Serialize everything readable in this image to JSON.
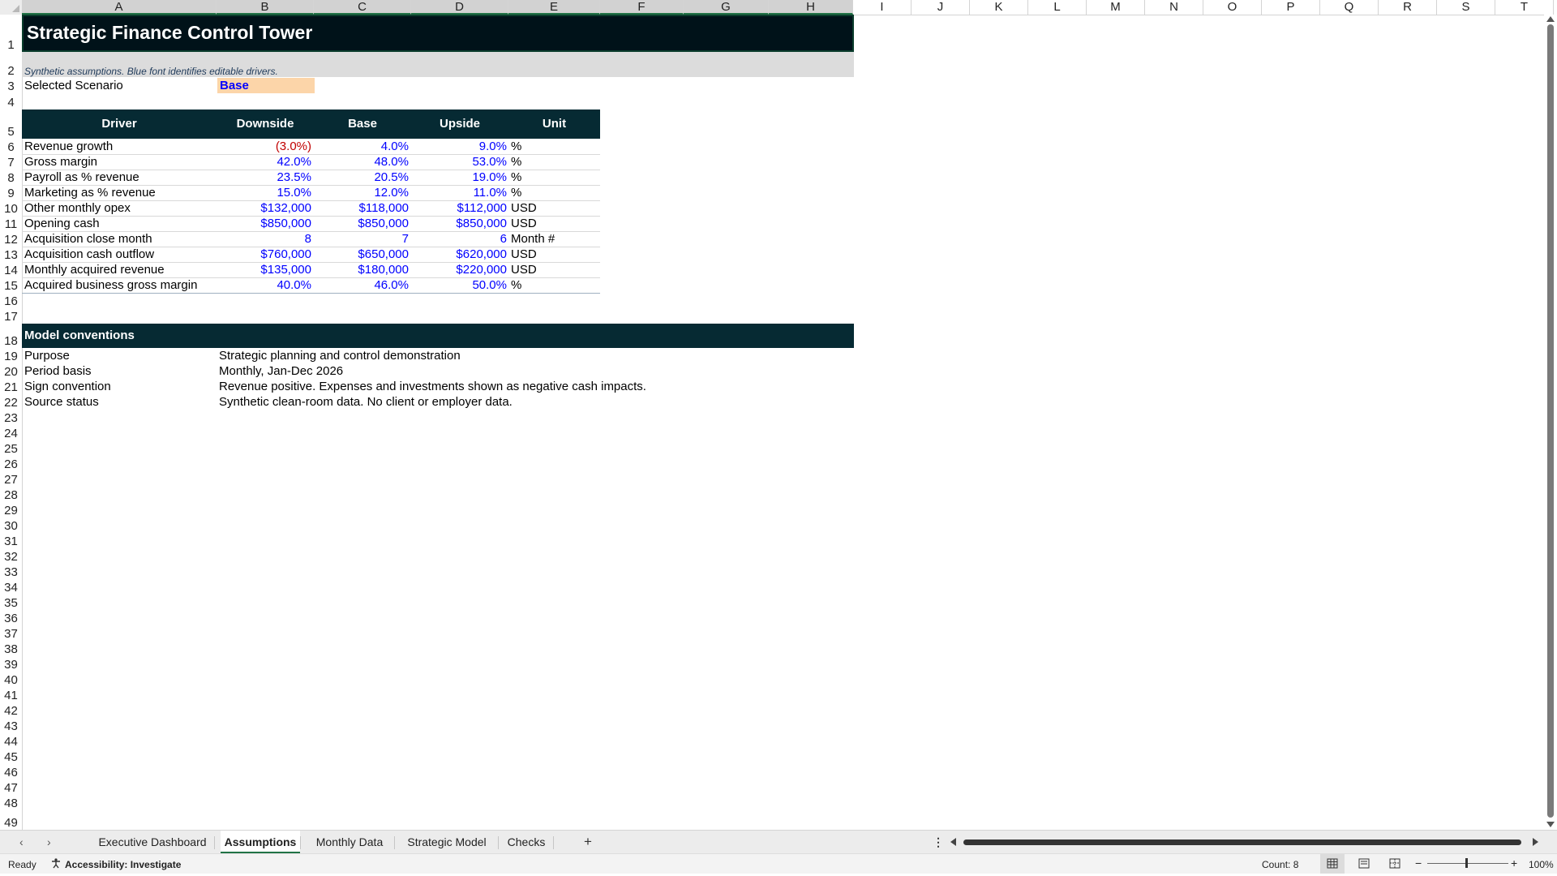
{
  "columns": [
    "A",
    "B",
    "C",
    "D",
    "E",
    "F",
    "G",
    "H",
    "I",
    "J",
    "K",
    "L",
    "M",
    "N",
    "O",
    "P",
    "Q",
    "R",
    "S",
    "T"
  ],
  "rows": [
    "1",
    "2",
    "3",
    "4",
    "5",
    "6",
    "7",
    "8",
    "9",
    "10",
    "11",
    "12",
    "13",
    "14",
    "15",
    "16",
    "17",
    "18",
    "19",
    "20",
    "21",
    "22",
    "23",
    "24",
    "25",
    "26",
    "27",
    "28",
    "29",
    "30",
    "31",
    "32",
    "33",
    "34",
    "35",
    "36",
    "37",
    "38",
    "39",
    "40",
    "41",
    "42",
    "43",
    "44",
    "45",
    "46",
    "47",
    "48",
    "49"
  ],
  "title": "Strategic Finance Control Tower",
  "note": "Synthetic assumptions. Blue font identifies editable drivers.",
  "scenario": {
    "label": "Selected Scenario",
    "value": "Base"
  },
  "drivers_table": {
    "headers": [
      "Driver",
      "Downside",
      "Base",
      "Upside",
      "Unit"
    ],
    "rows": [
      {
        "driver": "Revenue growth",
        "downside": "(3.0%)",
        "base": "4.0%",
        "upside": "9.0%",
        "unit": "%"
      },
      {
        "driver": "Gross margin",
        "downside": "42.0%",
        "base": "48.0%",
        "upside": "53.0%",
        "unit": "%"
      },
      {
        "driver": "Payroll as % revenue",
        "downside": "23.5%",
        "base": "20.5%",
        "upside": "19.0%",
        "unit": "%"
      },
      {
        "driver": "Marketing as % revenue",
        "downside": "15.0%",
        "base": "12.0%",
        "upside": "11.0%",
        "unit": "%"
      },
      {
        "driver": "Other monthly opex",
        "downside": "$132,000",
        "base": "$118,000",
        "upside": "$112,000",
        "unit": "USD"
      },
      {
        "driver": "Opening cash",
        "downside": "$850,000",
        "base": "$850,000",
        "upside": "$850,000",
        "unit": "USD"
      },
      {
        "driver": "Acquisition close month",
        "downside": "8",
        "base": "7",
        "upside": "6",
        "unit": "Month #"
      },
      {
        "driver": "Acquisition cash outflow",
        "downside": "$760,000",
        "base": "$650,000",
        "upside": "$620,000",
        "unit": "USD"
      },
      {
        "driver": "Monthly acquired revenue",
        "downside": "$135,000",
        "base": "$180,000",
        "upside": "$220,000",
        "unit": "USD"
      },
      {
        "driver": "Acquired business gross margin",
        "downside": "40.0%",
        "base": "46.0%",
        "upside": "50.0%",
        "unit": "%"
      }
    ]
  },
  "conventions": {
    "header": "Model conventions",
    "rows": [
      {
        "key": "Purpose",
        "value": "Strategic planning and control demonstration"
      },
      {
        "key": "Period basis",
        "value": "Monthly, Jan-Dec 2026"
      },
      {
        "key": "Sign convention",
        "value": "Revenue positive. Expenses and investments shown as negative cash impacts."
      },
      {
        "key": "Source status",
        "value": "Synthetic clean-room data. No client or employer data."
      }
    ]
  },
  "sheet_tabs": [
    "Executive Dashboard",
    "Assumptions",
    "Monthly Data",
    "Strategic Model",
    "Checks"
  ],
  "active_tab": "Assumptions",
  "add_sheet_symbol": "+",
  "status": {
    "ready": "Ready",
    "accessibility": "Accessibility: Investigate",
    "count": "Count: 8",
    "zoom": "100%"
  },
  "icons": [
    "prev-sheet-icon",
    "next-sheet-icon",
    "add-sheet-icon",
    "more-options-icon",
    "accessibility-icon",
    "normal-view-icon",
    "page-layout-icon",
    "page-break-icon",
    "zoom-out-icon",
    "zoom-in-icon"
  ],
  "colors": {
    "title_bg": "#001219",
    "header_bg": "#062a33",
    "input_blue": "#0000ff",
    "negative_red": "#c00000",
    "scenario_fill": "#fcd5a9",
    "excel_green": "#217346"
  }
}
